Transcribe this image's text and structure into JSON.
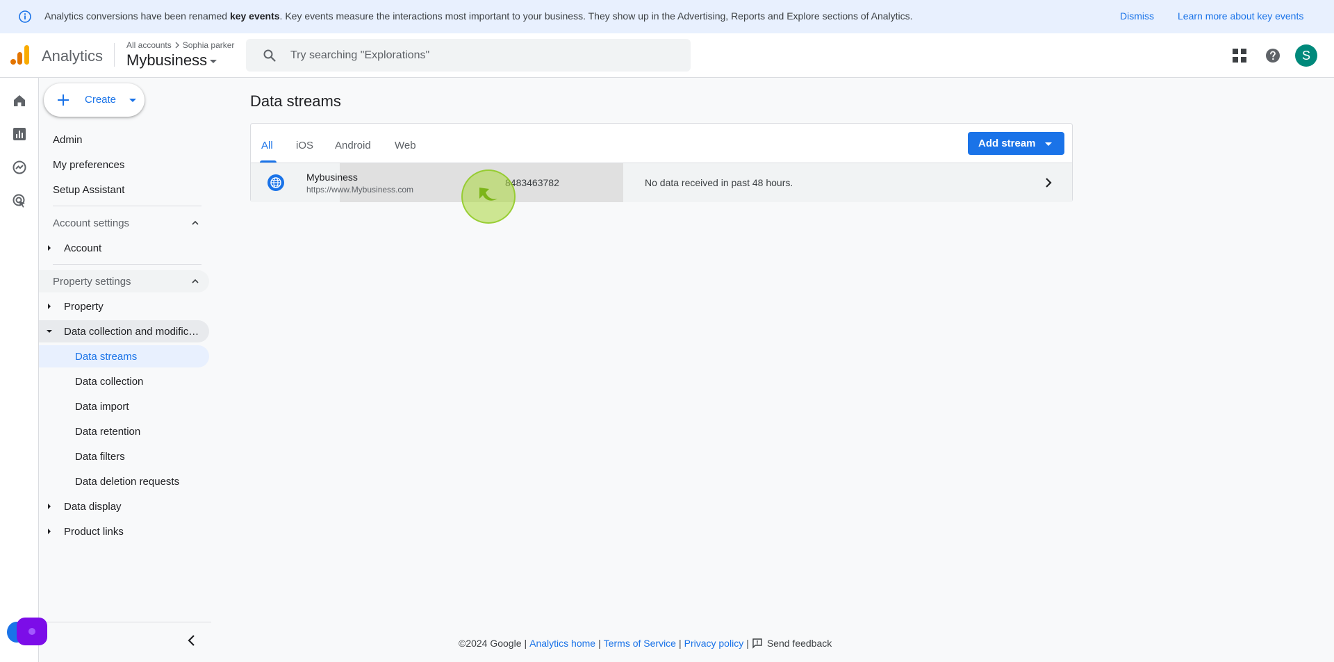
{
  "banner": {
    "message_prefix": "Analytics conversions have been renamed ",
    "message_bold": "key events",
    "message_suffix": ". Key events measure the interactions most important to your business. They show up in the Advertising, Reports and Explore sections of Analytics.",
    "dismiss_label": "Dismiss",
    "learn_more_label": "Learn more about key events"
  },
  "header": {
    "app_name": "Analytics",
    "breadcrumb_root": "All accounts",
    "breadcrumb_account": "Sophia parker",
    "property_name": "Mybusiness",
    "search_placeholder": "Try searching \"Explorations\"",
    "avatar_letter": "S"
  },
  "sidenav": {
    "create_label": "Create",
    "top_items": [
      "Admin",
      "My preferences",
      "Setup Assistant"
    ],
    "account_settings": {
      "title": "Account settings",
      "items": [
        "Account"
      ]
    },
    "property_settings": {
      "title": "Property settings",
      "property": "Property",
      "data_collection": "Data collection and modifica...",
      "sub_items": [
        "Data streams",
        "Data collection",
        "Data import",
        "Data retention",
        "Data filters",
        "Data deletion requests"
      ],
      "data_display": "Data display",
      "product_links": "Product links"
    }
  },
  "main": {
    "title": "Data streams",
    "tabs": [
      "All",
      "iOS",
      "Android",
      "Web"
    ],
    "active_tab": "All",
    "add_stream_label": "Add stream",
    "streams": [
      {
        "name": "Mybusiness",
        "url": "https://www.Mybusiness.com",
        "stream_id": "8483463782",
        "status": "No data received in past 48 hours."
      }
    ]
  },
  "footer": {
    "copyright": "©2024 Google",
    "analytics_home": "Analytics home",
    "terms": "Terms of Service",
    "privacy": "Privacy policy",
    "feedback": "Send feedback"
  },
  "colors": {
    "accent": "#1a73e8",
    "banner_bg": "#e8f0fe",
    "avatar_bg": "#00897b",
    "logo_orange": "#f9ab00",
    "logo_dark_orange": "#e37400"
  }
}
